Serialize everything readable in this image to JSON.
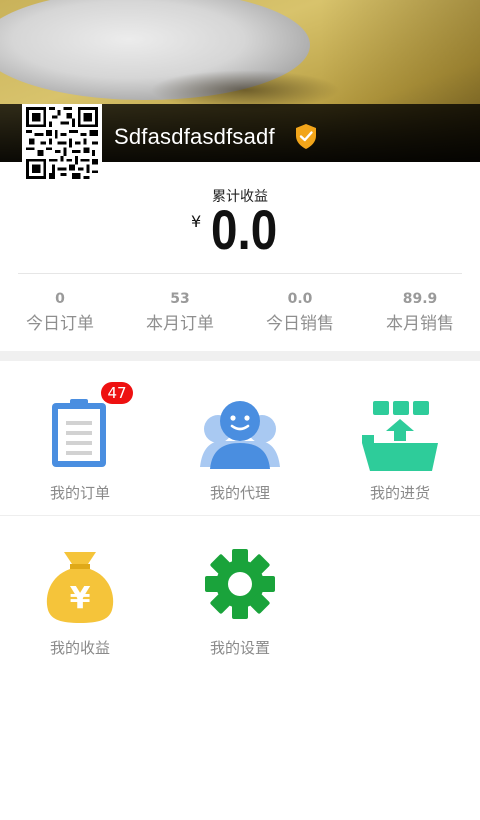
{
  "profile": {
    "username": "Sdfasdfasdfsadf",
    "verified_icon": "shield-check-icon",
    "qr_icon": "qr-code-icon"
  },
  "earnings": {
    "label": "累计收益",
    "currency": "¥",
    "amount": "0.0"
  },
  "stats": [
    {
      "value": "0",
      "label": "今日订单"
    },
    {
      "value": "53",
      "label": "本月订单"
    },
    {
      "value": "0.0",
      "label": "今日销售"
    },
    {
      "value": "89.9",
      "label": "本月销售"
    }
  ],
  "menu": [
    {
      "label": "我的订单",
      "icon": "clipboard-icon",
      "badge": "47"
    },
    {
      "label": "我的代理",
      "icon": "agents-icon"
    },
    {
      "label": "我的进货",
      "icon": "restock-ship-icon"
    },
    {
      "label": "我的收益",
      "icon": "money-bag-icon"
    },
    {
      "label": "我的设置",
      "icon": "gear-icon"
    }
  ],
  "colors": {
    "accent_blue": "#4a8ee0",
    "accent_green": "#2ecc9a",
    "gold": "#f5c43a",
    "gear_green": "#1aa33b",
    "badge_red": "#ee1111",
    "verified_orange": "#f2a51a"
  }
}
